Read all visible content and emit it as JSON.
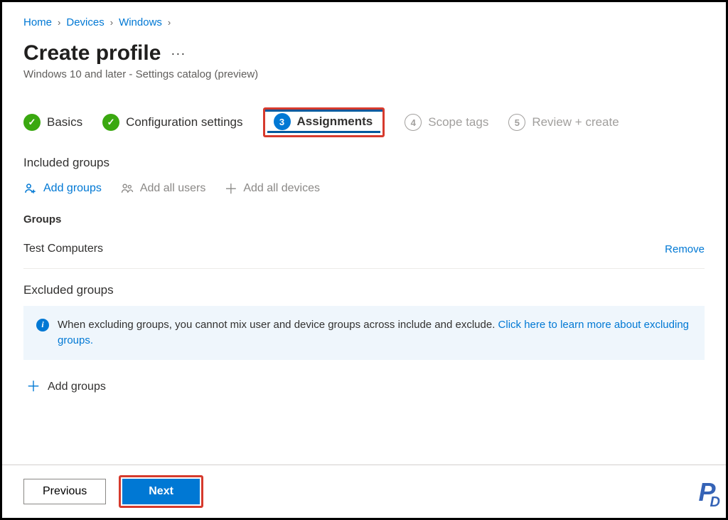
{
  "breadcrumb": {
    "items": [
      "Home",
      "Devices",
      "Windows"
    ]
  },
  "page": {
    "title": "Create profile",
    "subtitle": "Windows 10 and later - Settings catalog (preview)"
  },
  "steps": {
    "s1": {
      "label": "Basics"
    },
    "s2": {
      "label": "Configuration settings"
    },
    "s3": {
      "num": "3",
      "label": "Assignments"
    },
    "s4": {
      "num": "4",
      "label": "Scope tags"
    },
    "s5": {
      "num": "5",
      "label": "Review + create"
    }
  },
  "included": {
    "title": "Included groups",
    "actions": {
      "add_groups": "Add groups",
      "add_all_users": "Add all users",
      "add_all_devices": "Add all devices"
    },
    "groups_header": "Groups",
    "rows": [
      {
        "name": "Test Computers",
        "remove": "Remove"
      }
    ]
  },
  "excluded": {
    "title": "Excluded groups",
    "info_text": "When excluding groups, you cannot mix user and device groups across include and exclude. ",
    "info_link": "Click here to learn more about excluding groups.",
    "add_groups": "Add groups"
  },
  "footer": {
    "previous": "Previous",
    "next": "Next"
  }
}
